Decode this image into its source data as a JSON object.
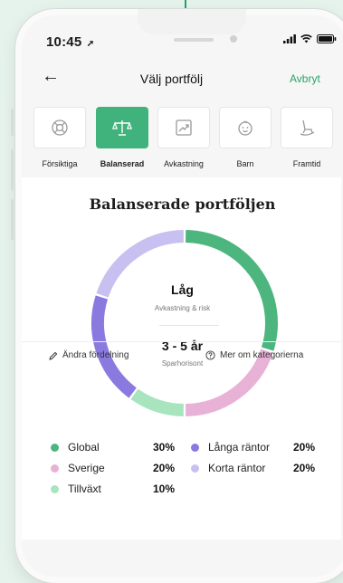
{
  "status": {
    "time": "10:45"
  },
  "nav": {
    "title": "Välj portfölj",
    "cancel_label": "Avbryt"
  },
  "categories": [
    {
      "label": "Försiktiga",
      "icon": "lifebuoy-icon",
      "active": false
    },
    {
      "label": "Balanserad",
      "icon": "scale-icon",
      "active": true
    },
    {
      "label": "Avkastning",
      "icon": "chart-up-icon",
      "active": false
    },
    {
      "label": "Barn",
      "icon": "baby-icon",
      "active": false
    },
    {
      "label": "Framtid",
      "icon": "rocking-chair-icon",
      "active": false
    }
  ],
  "portfolio": {
    "title": "Balanserade portföljen",
    "risk_value": "Låg",
    "risk_label": "Avkastning & risk",
    "horizon_value": "3 - 5 år",
    "horizon_label": "Sparhorisont"
  },
  "chart_data": {
    "type": "pie",
    "style": "donut",
    "slices": [
      {
        "name": "Global",
        "value": 30,
        "color": "#4db67e"
      },
      {
        "name": "Sverige",
        "value": 20,
        "color": "#e8b2d7"
      },
      {
        "name": "Tillväxt",
        "value": 10,
        "color": "#a8e5bf"
      },
      {
        "name": "Långa räntor",
        "value": 20,
        "color": "#8a7ae0"
      },
      {
        "name": "Korta räntor",
        "value": 20,
        "color": "#c8c0f0"
      }
    ]
  },
  "legend": {
    "left": [
      {
        "name": "Global",
        "pct": "30%",
        "color": "#4db67e"
      },
      {
        "name": "Sverige",
        "pct": "20%",
        "color": "#e8b2d7"
      },
      {
        "name": "Tillväxt",
        "pct": "10%",
        "color": "#a8e5bf"
      }
    ],
    "right": [
      {
        "name": "Långa räntor",
        "pct": "20%",
        "color": "#8a7ae0"
      },
      {
        "name": "Korta räntor",
        "pct": "20%",
        "color": "#c8c0f0"
      }
    ]
  },
  "footer": {
    "edit_label": "Ändra fördelning",
    "info_label": "Mer om kategorierna"
  },
  "colors": {
    "accent": "#26a36a",
    "active_tab": "#40b27c"
  }
}
